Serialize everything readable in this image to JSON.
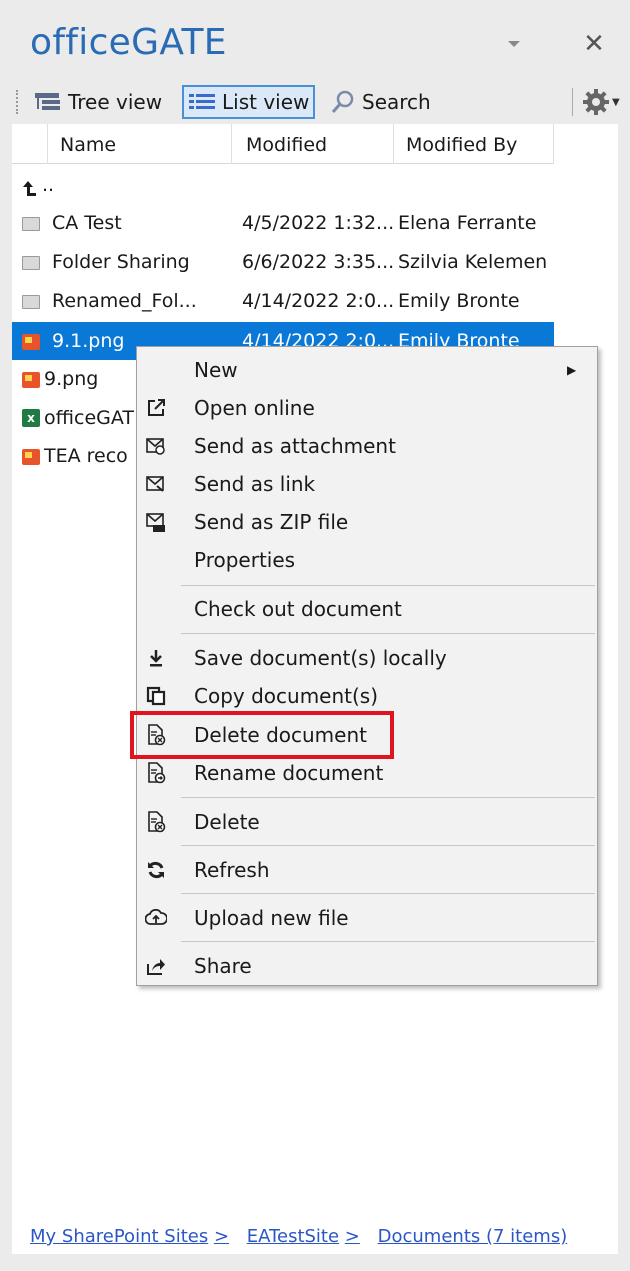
{
  "app": {
    "title": "officeGATE"
  },
  "toolbar": {
    "tree_view": "Tree view",
    "list_view": "List view",
    "search": "Search"
  },
  "table": {
    "columns": [
      "Name",
      "Modified",
      "Modified By"
    ],
    "up_label": "..",
    "rows": [
      {
        "name": "CA Test",
        "modified": "4/5/2022 1:32...",
        "by": "Elena Ferrante",
        "icon": "folder-icon"
      },
      {
        "name": "Folder Sharing",
        "modified": "6/6/2022 3:35...",
        "by": "Szilvia Kelemen",
        "icon": "folder-icon"
      },
      {
        "name": "Renamed_Fol...",
        "modified": "4/14/2022 2:0...",
        "by": "Emily Bronte",
        "icon": "folder-icon"
      },
      {
        "name": "9.1.png",
        "modified": "4/14/2022 2:0...",
        "by": "Emily Bronte",
        "icon": "image-icon",
        "selected": true
      },
      {
        "name": "9.png",
        "modified": "",
        "by": "",
        "icon": "image-icon"
      },
      {
        "name": "officeGAT",
        "modified": "",
        "by": "",
        "icon": "excel-icon"
      },
      {
        "name": "TEA reco",
        "modified": "",
        "by": "",
        "icon": "image-icon"
      }
    ]
  },
  "context_menu": {
    "items": [
      {
        "label": "New",
        "icon": "",
        "submenu": true
      },
      {
        "label": "Open online",
        "icon": "open-external-icon"
      },
      {
        "label": "Send as attachment",
        "icon": "mail-attachment-icon"
      },
      {
        "label": "Send as link",
        "icon": "mail-link-icon"
      },
      {
        "label": "Send as ZIP file",
        "icon": "mail-zip-icon"
      },
      {
        "label": "Properties",
        "icon": ""
      },
      {
        "label": "Check out document",
        "icon": ""
      },
      {
        "label": "Save document(s) locally",
        "icon": "download-icon"
      },
      {
        "label": "Copy document(s)",
        "icon": "copy-icon"
      },
      {
        "label": "Delete document",
        "icon": "delete-document-icon",
        "highlighted": true
      },
      {
        "label": "Rename document",
        "icon": "rename-document-icon"
      },
      {
        "label": "Delete",
        "icon": "delete-icon"
      },
      {
        "label": "Refresh",
        "icon": "refresh-icon"
      },
      {
        "label": "Upload new file",
        "icon": "upload-icon"
      },
      {
        "label": "Share",
        "icon": "share-icon"
      }
    ]
  },
  "breadcrumb": {
    "sites": "My SharePoint Sites",
    "site": "EATestSite",
    "library": "Documents (7 items)",
    "separator": ">"
  },
  "colors": {
    "title": "#2a6bb5",
    "selection": "#0a78d7",
    "highlight": "#e0141e",
    "link": "#2a56c6"
  }
}
